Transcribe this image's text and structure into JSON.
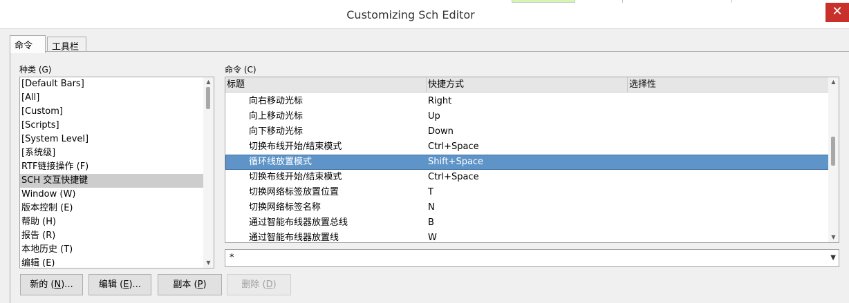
{
  "window": {
    "title": "Customizing Sch Editor"
  },
  "tabs": [
    {
      "label": "命令"
    },
    {
      "label": "工具栏"
    }
  ],
  "categories": {
    "label": "种类 (G)",
    "items": [
      "[Default Bars]",
      "[All]",
      "[Custom]",
      "[Scripts]",
      "[System Level]",
      "[系统级]",
      "RTF链接操作 (F)",
      "SCH 交互快捷键",
      "Window (W)",
      "版本控制 (E)",
      "帮助 (H)",
      "报告 (R)",
      "本地历史 (T)",
      "编辑 (E)"
    ],
    "selected": "SCH 交互快捷键"
  },
  "commands": {
    "label": "命令 (C)",
    "columns": [
      "标题",
      "快捷方式",
      "选择性"
    ],
    "rows": [
      {
        "name": "向右移动光标",
        "shortcut": "Right"
      },
      {
        "name": "向上移动光标",
        "shortcut": "Up"
      },
      {
        "name": "向下移动光标",
        "shortcut": "Down"
      },
      {
        "name": "切换布线开始/结束模式",
        "shortcut": "Ctrl+Space"
      },
      {
        "name": "循环线放置模式",
        "shortcut": "Shift+Space"
      },
      {
        "name": "切换布线开始/结束模式",
        "shortcut": "Ctrl+Space"
      },
      {
        "name": "切换网络标签放置位置",
        "shortcut": "T"
      },
      {
        "name": "切换网络标签名称",
        "shortcut": "N"
      },
      {
        "name": "通过智能布线器放置总线",
        "shortcut": "B"
      },
      {
        "name": "通过智能布线器放置线",
        "shortcut": "W"
      }
    ],
    "selected_index": 4
  },
  "filter": {
    "value": "*"
  },
  "buttons": {
    "new": {
      "label": "新的 (",
      "key": "N",
      "tail": ")..."
    },
    "edit": {
      "label": "编辑 (",
      "key": "E",
      "tail": ")..."
    },
    "copy": {
      "label": "副本 (",
      "key": "P",
      "tail": ")"
    },
    "delete": {
      "label": "删除 (",
      "key": "D",
      "tail": ")"
    }
  },
  "colors": {
    "selection": "#5f94c8",
    "close": "#c7302b"
  }
}
